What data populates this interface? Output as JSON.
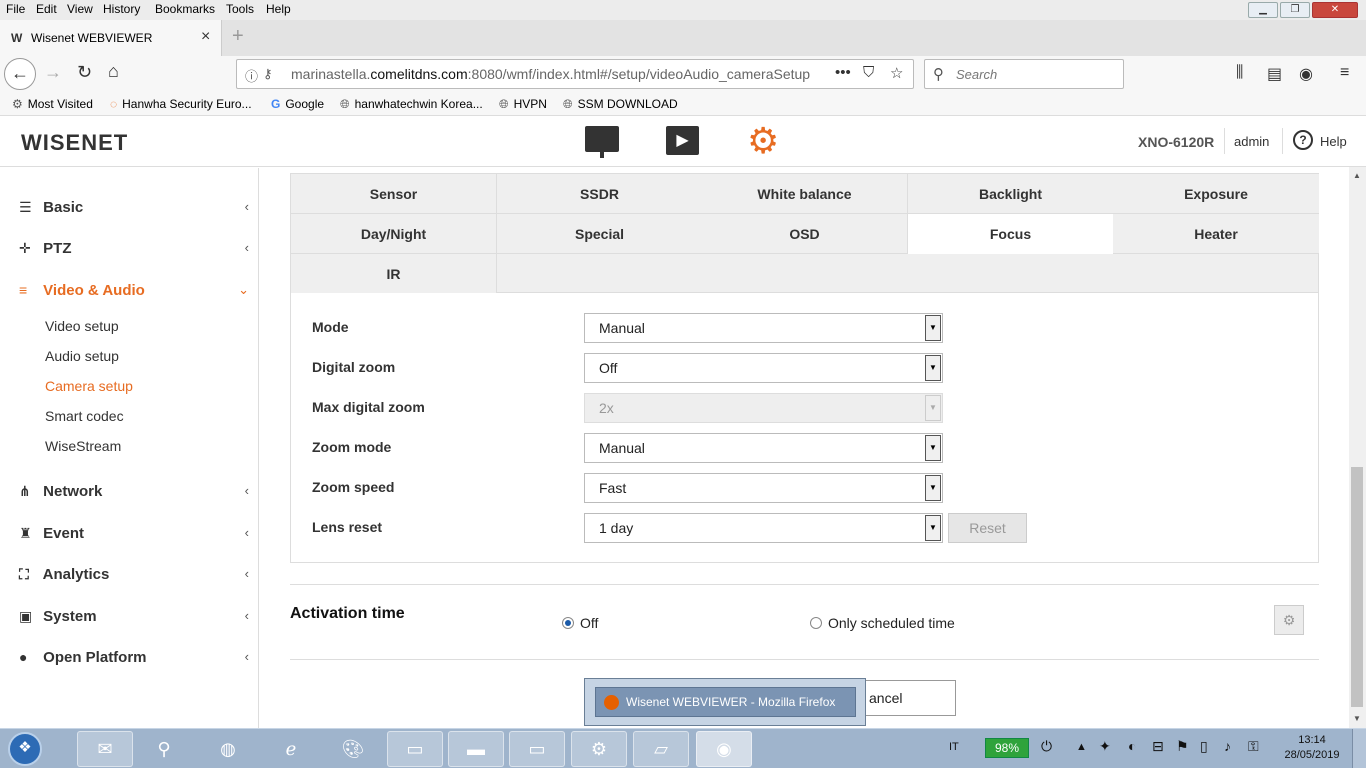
{
  "browser": {
    "menu": [
      "File",
      "Edit",
      "View",
      "History",
      "Bookmarks",
      "Tools",
      "Help"
    ],
    "tab": {
      "title": "Wisenet WEBVIEWER",
      "favicon": "W"
    },
    "url": {
      "prefix": "marinastella.",
      "host": "comelitdns.com",
      "rest": ":8080/wmf/index.html#/setup/videoAudio_cameraSetup"
    },
    "search_placeholder": "Search",
    "bookmarks": [
      "Most Visited",
      "Hanwha Security Euro...",
      "Google",
      "hanwhatechwin Korea...",
      "HVPN",
      "SSM DOWNLOAD"
    ]
  },
  "header": {
    "logo": "WISENET",
    "model": "XNO-6120R",
    "user": "admin",
    "help": "Help",
    "accent_color": "#e76c22"
  },
  "sidebar": {
    "items": [
      {
        "label": "Basic",
        "icon": "list-icon"
      },
      {
        "label": "PTZ",
        "icon": "move-icon"
      },
      {
        "label": "Video & Audio",
        "icon": "sliders-icon"
      },
      {
        "label": "Network",
        "icon": "network-icon"
      },
      {
        "label": "Event",
        "icon": "alarm-icon"
      },
      {
        "label": "Analytics",
        "icon": "analytics-icon"
      },
      {
        "label": "System",
        "icon": "system-icon"
      },
      {
        "label": "Open Platform",
        "icon": "platform-icon"
      }
    ],
    "subitems": [
      "Video setup",
      "Audio setup",
      "Camera setup",
      "Smart codec",
      "WiseStream"
    ]
  },
  "camera_tabs": [
    [
      "Sensor",
      "SSDR",
      "White balance",
      "Backlight",
      "Exposure"
    ],
    [
      "Day/Night",
      "Special",
      "OSD",
      "Focus",
      "Heater"
    ],
    [
      "IR"
    ]
  ],
  "selected_tab": "Focus",
  "form": {
    "rows": [
      {
        "label": "Mode",
        "value": "Manual"
      },
      {
        "label": "Digital zoom",
        "value": "Off"
      },
      {
        "label": "Max digital zoom",
        "value": "2x"
      },
      {
        "label": "Zoom mode",
        "value": "Manual"
      },
      {
        "label": "Zoom speed",
        "value": "Fast"
      },
      {
        "label": "Lens reset",
        "value": "1 day"
      }
    ],
    "reset_label": "Reset"
  },
  "activation": {
    "title": "Activation time",
    "off": "Off",
    "scheduled": "Only scheduled time"
  },
  "cancel_label": "ancel",
  "popup_title": "Wisenet WEBVIEWER - Mozilla Firefox",
  "taskbar": {
    "lang": "IT",
    "battery": "98%",
    "time": "13:14",
    "date": "28/05/2019"
  }
}
